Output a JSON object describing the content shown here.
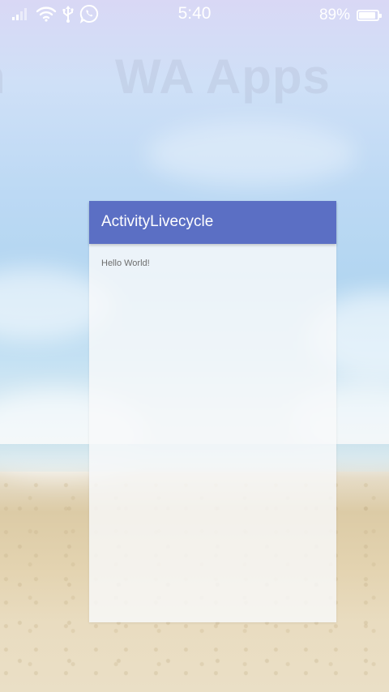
{
  "status_bar": {
    "time": "5:40",
    "battery_percent": "89%",
    "battery_level": 0.89,
    "icons": [
      "signal-icon",
      "wifi-icon",
      "usb-icon",
      "whatsapp-icon"
    ]
  },
  "background": {
    "label_left": "n",
    "label_right": "WA Apps"
  },
  "app": {
    "title": "ActivityLivecycle",
    "body_text": "Hello World!",
    "colors": {
      "app_bar": "#5b6fc4",
      "title_text": "#ffffff",
      "body_text": "#6d6d6d"
    }
  }
}
